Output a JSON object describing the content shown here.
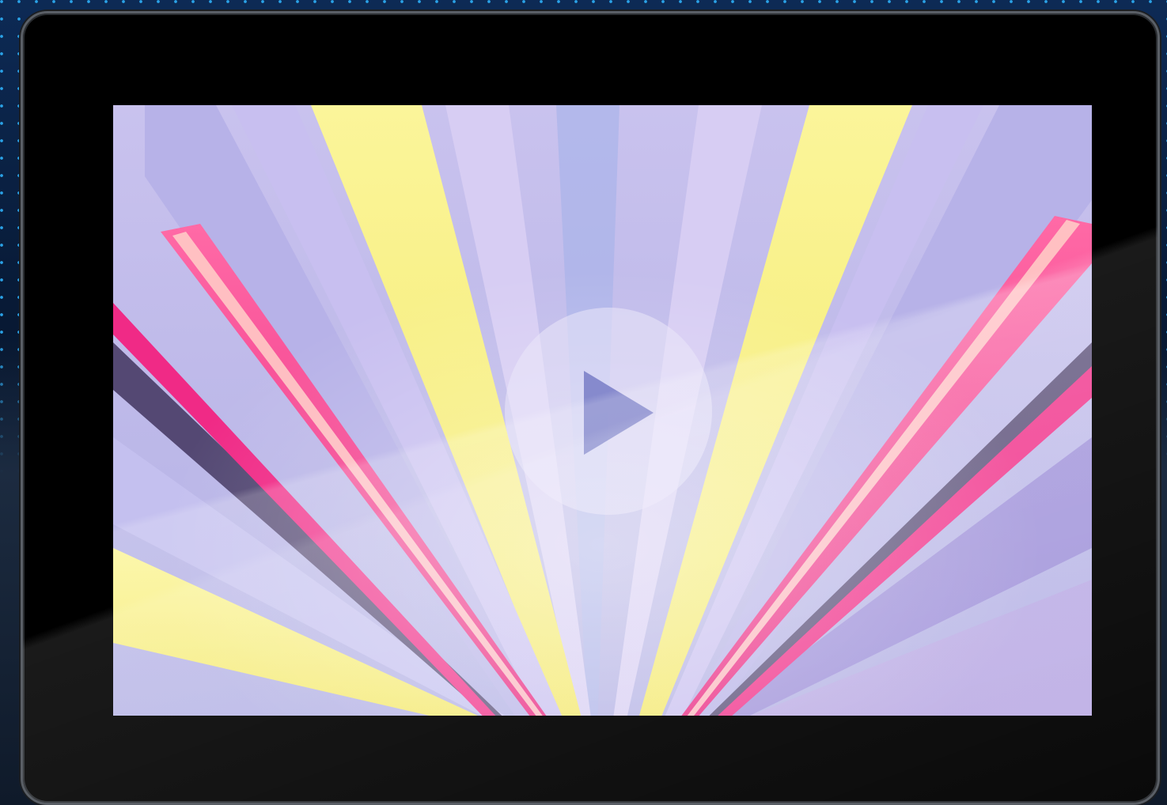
{
  "video": {
    "play_control": {
      "icon": "play-icon",
      "state": "paused"
    },
    "thumbnail": {
      "colors": {
        "lilac": "#b9b6e6",
        "lavender": "#a9b4ea",
        "yellow": "#f5ef7a",
        "magenta": "#f02a86",
        "pink_glow": "#ff9aa8",
        "dark_slot": "#3a2c55"
      }
    }
  },
  "frame": {
    "bezel_color": "#000000",
    "edge_color": "#5a5f66",
    "background_dots_color": "#2aa3e8"
  }
}
